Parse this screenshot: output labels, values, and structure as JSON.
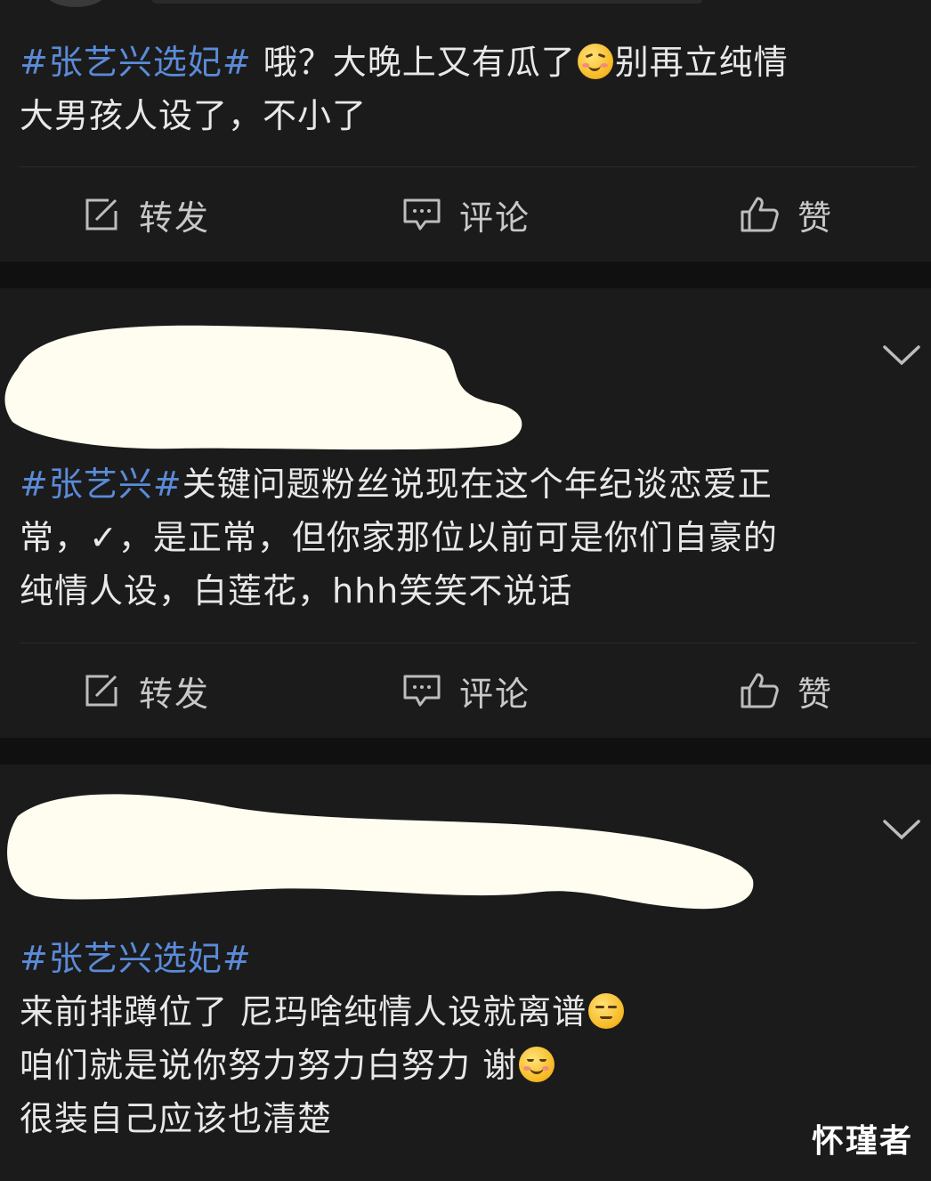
{
  "posts": [
    {
      "body": {
        "hashtag": "#张艺兴选妃#",
        "line1_rest": " 哦？大晚上又有瓜了",
        "line1_after_emoji": "别再立纯情",
        "line2": "大男孩人设了，不小了"
      },
      "emoji": "yum-face-icon",
      "actions": {
        "repost": "转发",
        "comment": "评论",
        "like": "赞"
      }
    },
    {
      "body": {
        "hashtag": "#张艺兴#",
        "line1_rest": "关键问题粉丝说现在这个年纪谈恋爱正",
        "line2": "常，✓，是正常，但你家那位以前可是你们自豪的",
        "line3": "纯情人设，白莲花，hhh笑笑不说话"
      },
      "actions": {
        "repost": "转发",
        "comment": "评论",
        "like": "赞"
      }
    },
    {
      "body": {
        "hashtag": "#张艺兴选妃#",
        "line2": "来前排蹲位了 尼玛啥纯情人设就离谱",
        "line3": "咱们就是说你努力努力白努力 谢",
        "line4": "很装自己应该也清楚"
      },
      "emojis": [
        "unamused-face-icon",
        "smiling-face-icon"
      ]
    }
  ],
  "watermark": "怀瑾者",
  "colors": {
    "hashtag": "#5b8bd8",
    "text": "#e8e8e8",
    "background": "#1b1b1b",
    "redaction": "#fffdf0"
  }
}
